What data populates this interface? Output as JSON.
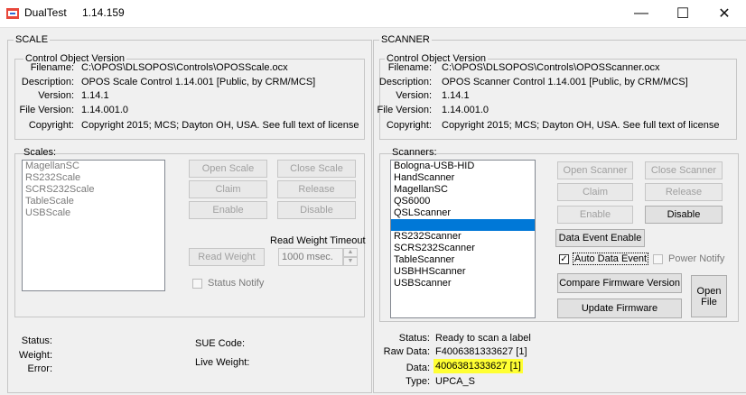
{
  "window": {
    "title": "DualTest",
    "version": "1.14.159",
    "minimize_icon": "minimize-icon",
    "maximize_icon": "maximize-icon",
    "close_icon": "close-icon"
  },
  "scale": {
    "group_label": "SCALE",
    "cov_label": "Control Object Version",
    "filename_label": "Filename:",
    "filename": "C:\\OPOS\\DLSOPOS\\Controls\\OPOSScale.ocx",
    "description_label": "Description:",
    "description": "OPOS Scale Control 1.14.001 [Public, by CRM/MCS]",
    "version_label": "Version:",
    "version": "1.14.1",
    "file_version_label": "File Version:",
    "file_version": "1.14.001.0",
    "copyright_label": "Copyright:",
    "copyright": "Copyright 2015; MCS; Dayton OH, USA. See full text of license",
    "list_label": "Scales:",
    "items": [
      "MagellanSC",
      "RS232Scale",
      "SCRS232Scale",
      "TableScale",
      "USBScale"
    ],
    "open_btn": "Open Scale",
    "close_btn": "Close Scale",
    "claim_btn": "Claim",
    "release_btn": "Release",
    "enable_btn": "Enable",
    "disable_btn": "Disable",
    "read_weight_btn": "Read Weight",
    "timeout_label": "Read Weight Timeout",
    "timeout_value": "1000 msec.",
    "status_notify": "Status Notify",
    "status_label": "Status:",
    "weight_label": "Weight:",
    "error_label": "Error:",
    "sue_code_label": "SUE Code:",
    "live_weight_label": "Live Weight:"
  },
  "scanner": {
    "group_label": "SCANNER",
    "cov_label": "Control Object Version",
    "filename_label": "Filename:",
    "filename": "C:\\OPOS\\DLSOPOS\\Controls\\OPOSScanner.ocx",
    "description_label": "Description:",
    "description": "OPOS Scanner Control 1.14.001 [Public, by CRM/MCS]",
    "version_label": "Version:",
    "version": "1.14.1",
    "file_version_label": "File Version:",
    "file_version": "1.14.001.0",
    "copyright_label": "Copyright:",
    "copyright": "Copyright 2015; MCS; Dayton OH, USA. See full text of license",
    "list_label": "Scanners:",
    "items": [
      "Bologna-USB-HID",
      "HandScanner",
      "MagellanSC",
      "QS6000",
      "QSLScanner",
      "",
      "RS232Scanner",
      "SCRS232Scanner",
      "TableScanner",
      "USBHHScanner",
      "USBScanner"
    ],
    "selected_index": 5,
    "open_btn": "Open Scanner",
    "close_btn": "Close Scanner",
    "claim_btn": "Claim",
    "release_btn": "Release",
    "enable_btn": "Enable",
    "disable_btn": "Disable",
    "data_event_enable_btn": "Data Event Enable",
    "auto_data_event": "Auto Data Event",
    "power_notify": "Power Notify",
    "compare_fw_btn": "Compare Firmware Version",
    "update_fw_btn": "Update Firmware",
    "open_file_btn_line1": "Open",
    "open_file_btn_line2": "File",
    "status_label": "Status:",
    "status": "Ready to scan a label",
    "raw_data_label": "Raw Data:",
    "raw_data": "F4006381333627  [1]",
    "data_label": "Data:",
    "data": "4006381333627  [1]",
    "type_label": "Type:",
    "type": "UPCA_S"
  },
  "colors": {
    "selection": "#0078d7",
    "highlight": "#ffff33"
  }
}
